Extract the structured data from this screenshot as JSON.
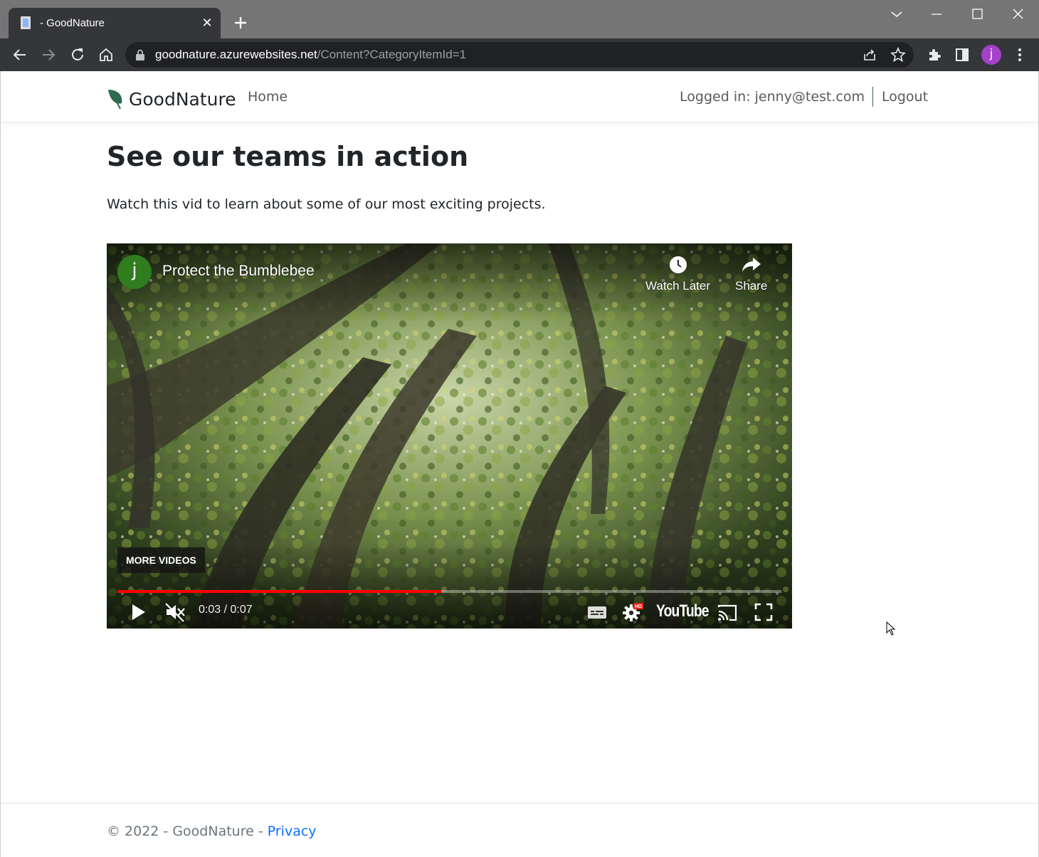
{
  "browser": {
    "tab_title": "- GoodNature",
    "url_host": "goodnature.azurewebsites.net",
    "url_path": "/Content?CategoryItemId=1",
    "profile_initial": "j"
  },
  "navbar": {
    "brand": "GoodNature",
    "home_label": "Home",
    "logged_in_text": "Logged in: jenny@test.com",
    "logout_label": "Logout",
    "brand_color": "#2e6b4f"
  },
  "content": {
    "heading": "See our teams in action",
    "lead": "Watch this vid to learn about some of our most exciting projects."
  },
  "video": {
    "channel_initial": "j",
    "title": "Protect the Bumblebee",
    "watch_later_label": "Watch Later",
    "share_label": "Share",
    "more_videos_label": "MORE VIDEOS",
    "time_text": "0:03 / 0:07",
    "progress_fraction": 0.4875,
    "youtube_label": "YouTube",
    "hd_badge": "HD"
  },
  "footer": {
    "copyright": "© 2022 - GoodNature - ",
    "privacy_label": "Privacy"
  }
}
